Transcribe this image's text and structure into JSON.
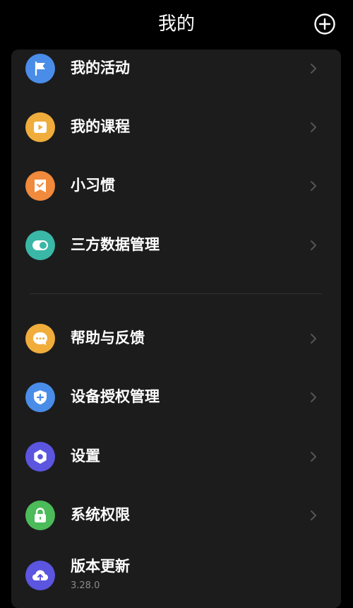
{
  "header": {
    "title": "我的",
    "add_icon": "plus-circle-icon"
  },
  "colors": {
    "activity": "#4a8de8",
    "course": "#f0ad3c",
    "habit": "#f08a3c",
    "thirdparty": "#3ab7a6",
    "help": "#f0ad3c",
    "auth": "#4a8de8",
    "settings": "#5b55e0",
    "permission": "#4cbb5a",
    "update": "#5b55e0"
  },
  "menu_group_1": [
    {
      "label": "我的活动",
      "icon": "flag-icon"
    },
    {
      "label": "我的课程",
      "icon": "play-icon"
    },
    {
      "label": "小习惯",
      "icon": "bookmark-check-icon"
    },
    {
      "label": "三方数据管理",
      "icon": "toggle-icon"
    }
  ],
  "menu_group_2": [
    {
      "label": "帮助与反馈",
      "icon": "chat-bubble-icon"
    },
    {
      "label": "设备授权管理",
      "icon": "shield-plus-icon"
    },
    {
      "label": "设置",
      "icon": "hexagon-gear-icon"
    },
    {
      "label": "系统权限",
      "icon": "lock-icon"
    },
    {
      "label": "版本更新",
      "sub": "3.28.0",
      "icon": "cloud-upload-icon"
    }
  ]
}
